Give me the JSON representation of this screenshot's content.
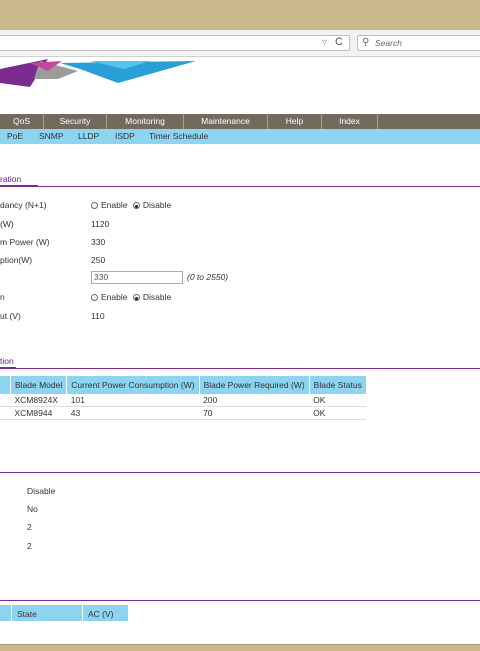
{
  "browser": {
    "search_placeholder": "Search",
    "dropdown_glyph": "▿",
    "reload_glyph": "C",
    "search_glyph": "⚲"
  },
  "menu": [
    {
      "label": "QoS"
    },
    {
      "label": "Security"
    },
    {
      "label": "Monitoring"
    },
    {
      "label": "Maintenance"
    },
    {
      "label": "Help"
    },
    {
      "label": "Index"
    }
  ],
  "submenu": [
    "PoE",
    "SNMP",
    "LLDP",
    "ISDP",
    "Timer Schedule"
  ],
  "config": {
    "tab": "ration",
    "rows": [
      {
        "label": "dancy (N+1)",
        "type": "radio",
        "options": [
          "Enable",
          "Disable"
        ],
        "selected": "Disable"
      },
      {
        "label": "(W)",
        "value": "1120"
      },
      {
        "label": "m Power (W)",
        "value": "330"
      },
      {
        "label": "ption(W)",
        "value": "250"
      },
      {
        "label": "",
        "input_value": "330",
        "hint": "(0 to 2550)"
      },
      {
        "label": "",
        "type": "radio",
        "options": [
          "Enable",
          "Disable"
        ],
        "selected": "Disable"
      },
      {
        "label": "ut (V)",
        "value": "110"
      }
    ]
  },
  "blade_section": {
    "tab": "tion",
    "headers": [
      "Blade Model",
      "Current Power Consumption (W)",
      "Blade Power Required (W)",
      "Blade Status"
    ],
    "rows": [
      [
        "XCM8924X",
        "101",
        "200",
        "OK"
      ],
      [
        "XCM8944",
        "43",
        "70",
        "OK"
      ]
    ]
  },
  "third_section": {
    "values": [
      "Disable",
      "No",
      "2",
      "2"
    ]
  },
  "bottom_table": {
    "headers": [
      "State",
      "AC (V)"
    ]
  },
  "colors": {
    "menu_bg": "#75695e",
    "submenu_bg": "#8dd4f1",
    "accent_purple": "#7c2b92",
    "window_frame": "#c9b98d"
  }
}
